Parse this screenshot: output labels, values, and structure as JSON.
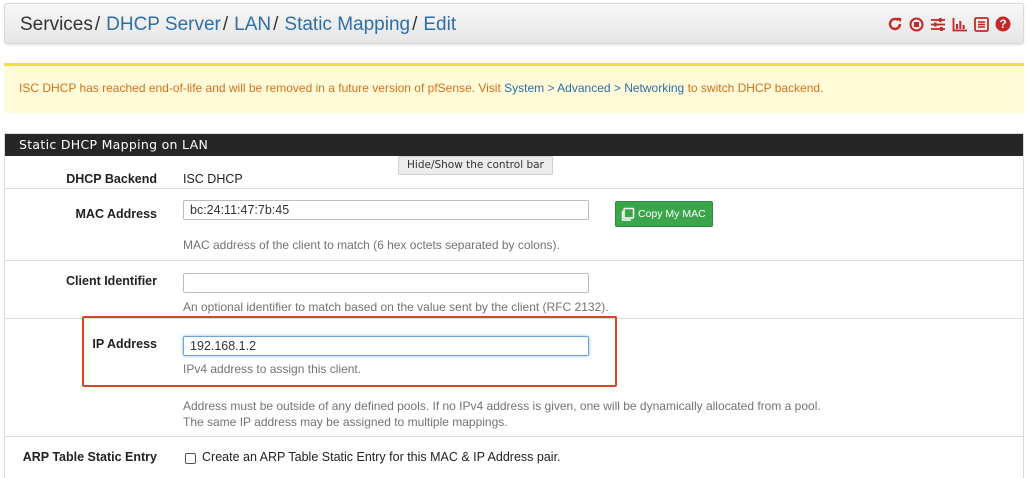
{
  "breadcrumb": {
    "root": "Services",
    "items": [
      "DHCP Server",
      "LAN",
      "Static Mapping",
      "Edit"
    ],
    "separator": "/"
  },
  "header_icons": [
    "restart-icon",
    "stop-icon",
    "settings-sliders-icon",
    "chart-icon",
    "log-list-icon",
    "help-icon"
  ],
  "notice": {
    "text_before": "ISC DHCP has reached end-of-life and will be removed in a future version of pfSense. Visit ",
    "link": "System > Advanced > Networking",
    "text_after": " to switch DHCP backend."
  },
  "panel": {
    "title": "Static DHCP Mapping on LAN",
    "tooltip": "Hide/Show the control bar"
  },
  "fields": {
    "backend": {
      "label": "DHCP Backend",
      "value": "ISC DHCP"
    },
    "mac": {
      "label": "MAC Address",
      "value": "bc:24:11:47:7b:45",
      "button": "Copy My MAC",
      "help": "MAC address of the client to match (6 hex octets separated by colons)."
    },
    "client_id": {
      "label": "Client Identifier",
      "value": "",
      "help": "An optional identifier to match based on the value sent by the client (RFC 2132)."
    },
    "ip": {
      "label": "IP Address",
      "value": "192.168.1.2",
      "help": "IPv4 address to assign this client.",
      "note_line1": "Address must be outside of any defined pools. If no IPv4 address is given, one will be dynamically allocated from a pool.",
      "note_line2": "The same IP address may be assigned to multiple mappings."
    },
    "arp": {
      "label": "ARP Table Static Entry",
      "checked": false,
      "checkbox_label": "Create an ARP Table Static Entry for this MAC & IP Address pair."
    }
  },
  "colors": {
    "link": "#2f6ea7",
    "notice_text": "#d6711a",
    "header_icon": "#c62828",
    "highlight": "#d9432a",
    "button": "#3aa54a"
  }
}
